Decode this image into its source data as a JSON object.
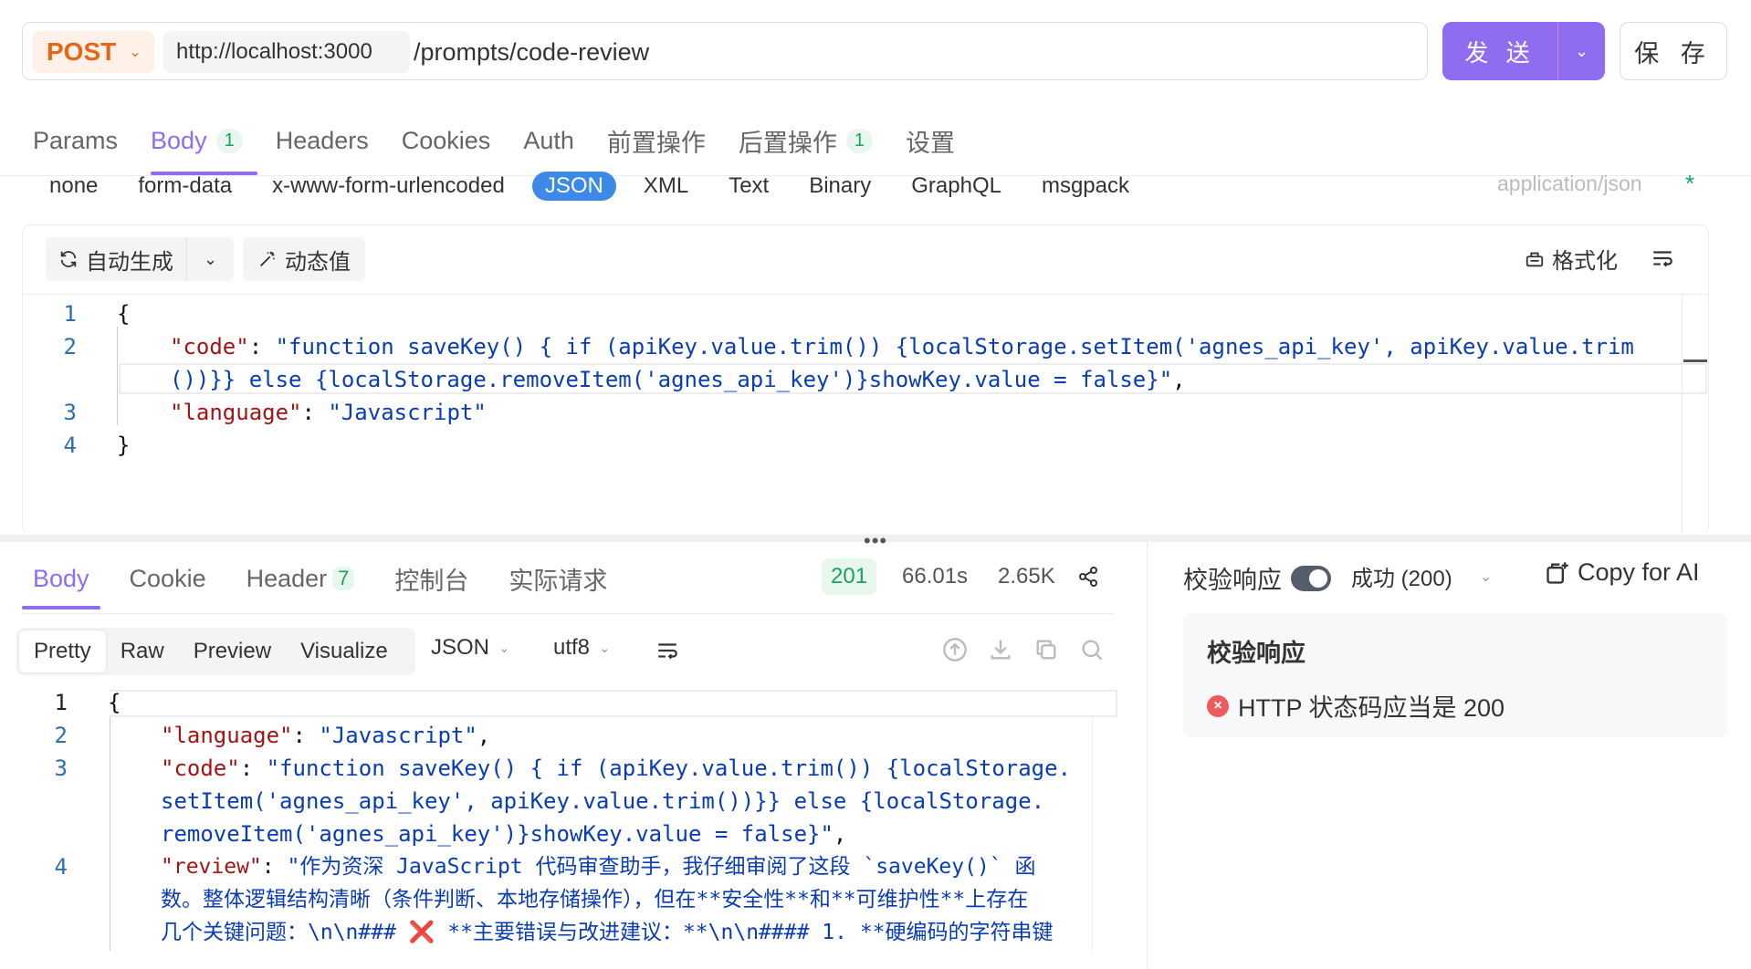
{
  "request": {
    "method": "POST",
    "base_url": "http://localhost:3000",
    "path": "/prompts/code-review",
    "send_label": "发 送",
    "save_label": "保 存"
  },
  "request_tabs": [
    {
      "label": "Params"
    },
    {
      "label": "Body",
      "badge": "1"
    },
    {
      "label": "Headers"
    },
    {
      "label": "Cookies"
    },
    {
      "label": "Auth"
    },
    {
      "label": "前置操作"
    },
    {
      "label": "后置操作",
      "badge": "1"
    },
    {
      "label": "设置"
    }
  ],
  "body_types": [
    "none",
    "form-data",
    "x-www-form-urlencoded",
    "JSON",
    "XML",
    "Text",
    "Binary",
    "GraphQL",
    "msgpack"
  ],
  "body_type_selected": "JSON",
  "content_type": "application/json",
  "content_type_marker": "*",
  "editor_toolbar": {
    "auto_generate": "自动生成",
    "dynamic_value": "动态值",
    "format": "格式化"
  },
  "request_body_lines": [
    {
      "num": "1",
      "text": "{"
    },
    {
      "num": "2",
      "key": "\"code\"",
      "value": "\"function saveKey() { if (apiKey.value.trim()) {localStorage.setItem('agnes_api_key', apiKey.value.trim",
      "cont": "())}} else {localStorage.removeItem('agnes_api_key')}showKey.value = false}\"",
      "tail": ","
    },
    {
      "num": "3",
      "key": "\"language\"",
      "value": "\"Javascript\""
    },
    {
      "num": "4",
      "text": "}"
    }
  ],
  "response_tabs": [
    {
      "label": "Body"
    },
    {
      "label": "Cookie"
    },
    {
      "label": "Header",
      "badge": "7"
    },
    {
      "label": "控制台"
    },
    {
      "label": "实际请求"
    }
  ],
  "response_meta": {
    "status": "201",
    "time": "66.01s",
    "size": "2.65K"
  },
  "view_modes": [
    "Pretty",
    "Raw",
    "Preview",
    "Visualize"
  ],
  "view_mode_selected": "Pretty",
  "response_format": "JSON",
  "response_encoding": "utf8",
  "response_lines": [
    {
      "num": "1",
      "text": "{"
    },
    {
      "num": "2",
      "key": "\"language\"",
      "value": "\"Javascript\"",
      "tail": ","
    },
    {
      "num": "3",
      "key": "\"code\"",
      "value": "\"function saveKey() { if (apiKey.value.trim()) {localStorage.",
      "cont1": "setItem('agnes_api_key', apiKey.value.trim())}} else {localStorage.",
      "cont2": "removeItem('agnes_api_key')}showKey.value = false}\"",
      "tail": ","
    },
    {
      "num": "4",
      "key": "\"review\"",
      "value": "\"作为资深 JavaScript 代码审查助手，我仔细审阅了这段 `saveKey()` 函",
      "cont1": "数。整体逻辑结构清晰（条件判断、本地存储操作），但在**安全性**和**可维护性**上存在",
      "cont2a": "几个关键问题：\\n\\n### ",
      "cont2x": "❌",
      "cont2b": " **主要错误与改进建议：**\\n\\n#### 1. **硬编码的字符串键"
    }
  ],
  "verify": {
    "toggle_label": "校验响应",
    "result_select": "成功 (200)",
    "copy_for_ai": "Copy for AI",
    "card_title": "校验响应",
    "assertion": "HTTP 状态码应当是 200"
  },
  "colors": {
    "accent": "#8f6cf0",
    "method": "#e8651a",
    "json_selected": "#3c89e8",
    "success": "#1aa35c",
    "error": "#ef5b5b"
  }
}
